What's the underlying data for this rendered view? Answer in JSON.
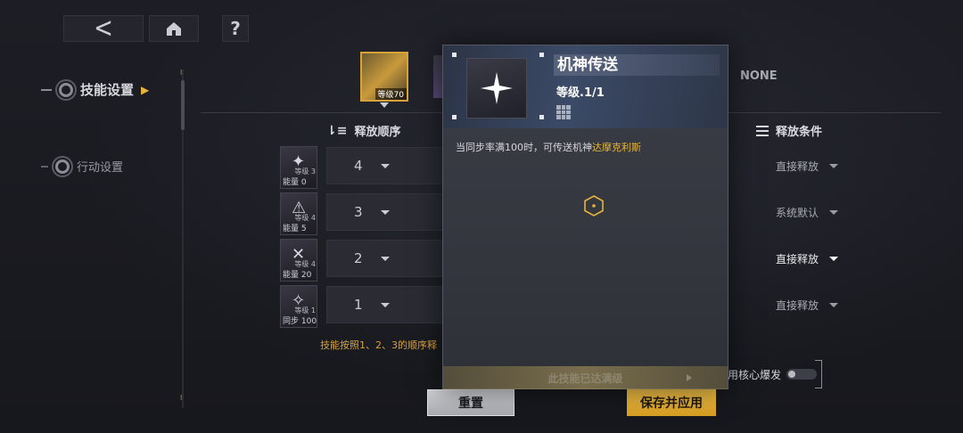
{
  "topbar": {
    "back_icon": "chevron-left-icon",
    "home_icon": "home-icon",
    "help_label": "?"
  },
  "sidebar": {
    "items": [
      {
        "label": "技能设置",
        "active": true
      },
      {
        "label": "行动设置",
        "active": false
      }
    ]
  },
  "characters": {
    "selected_level": "等级70",
    "none_label": "NONE"
  },
  "columns": {
    "order_header": "释放顺序",
    "condition_header": "释放条件"
  },
  "skills": [
    {
      "cost_label": "能量",
      "cost_value": "0",
      "lv_label": "等级",
      "lv_value": "3",
      "order": "4",
      "condition": "直接释放",
      "glyph": "✦"
    },
    {
      "cost_label": "能量",
      "cost_value": "5",
      "lv_label": "等级",
      "lv_value": "4",
      "order": "3",
      "condition": "系统默认",
      "glyph": "⚠"
    },
    {
      "cost_label": "能量",
      "cost_value": "20",
      "lv_label": "等级",
      "lv_value": "4",
      "order": "2",
      "condition": "直接释放",
      "glyph": "✕"
    },
    {
      "cost_label": "同步",
      "cost_value": "100",
      "lv_label": "等级",
      "lv_value": "1",
      "order": "1",
      "condition": "直接释放",
      "glyph": "✧"
    }
  ],
  "hint": "技能按照1、2、3的顺序释",
  "core_burst_label": "用核心爆发",
  "buttons": {
    "reset": "重置",
    "save": "保存并应用"
  },
  "popup": {
    "title": "机神传送",
    "level": "等级.1/1",
    "desc_prefix": "当同步率满100时，可传送机神",
    "desc_highlight": "达摩克利斯",
    "maxed_label": "此技能已达满级"
  },
  "colors": {
    "accent": "#e6b43a",
    "background": "#1a1b21",
    "panel": "#3c3e47"
  }
}
